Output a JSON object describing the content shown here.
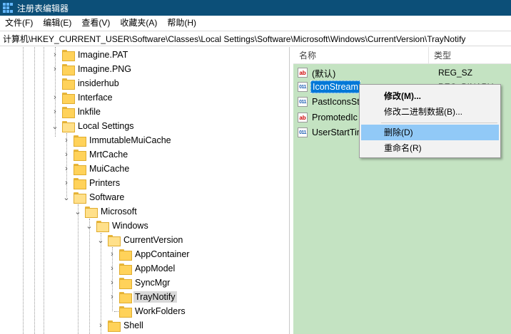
{
  "window": {
    "title": "注册表编辑器"
  },
  "menu": [
    "文件(F)",
    "编辑(E)",
    "查看(V)",
    "收藏夹(A)",
    "帮助(H)"
  ],
  "address": "计算机\\HKEY_CURRENT_USER\\Software\\Classes\\Local Settings\\Software\\Microsoft\\Windows\\CurrentVersion\\TrayNotify",
  "tree": {
    "nodes": [
      {
        "label": "Imagine.PAT",
        "expander": ">"
      },
      {
        "label": "Imagine.PNG",
        "expander": ">"
      },
      {
        "label": "insiderhub",
        "expander": ""
      },
      {
        "label": "Interface",
        "expander": ">"
      },
      {
        "label": "lnkfile",
        "expander": ">"
      },
      {
        "label": "Local Settings",
        "expander": "v"
      },
      {
        "label": "ImmutableMuiCache",
        "expander": ">"
      },
      {
        "label": "MrtCache",
        "expander": ">"
      },
      {
        "label": "MuiCache",
        "expander": ">"
      },
      {
        "label": "Printers",
        "expander": ">"
      },
      {
        "label": "Software",
        "expander": "v"
      },
      {
        "label": "Microsoft",
        "expander": "v"
      },
      {
        "label": "Windows",
        "expander": "v"
      },
      {
        "label": "CurrentVersion",
        "expander": "v"
      },
      {
        "label": "AppContainer",
        "expander": ">"
      },
      {
        "label": "AppModel",
        "expander": ">"
      },
      {
        "label": "SyncMgr",
        "expander": ">"
      },
      {
        "label": "TrayNotify",
        "expander": ">",
        "selected": true
      },
      {
        "label": "WorkFolders",
        "expander": ""
      },
      {
        "label": "Shell",
        "expander": ">"
      }
    ]
  },
  "list": {
    "headers": {
      "name": "名称",
      "type": "类型"
    },
    "entries": [
      {
        "name": "(默认)",
        "type": "REG_SZ",
        "icon": "string-value-icon"
      },
      {
        "name": "IconStream",
        "type": "REG_BINARY",
        "icon": "binary-value-icon",
        "selected": true
      },
      {
        "name": "PastIconsSt",
        "type": "",
        "icon": "binary-value-icon"
      },
      {
        "name": "PromotedIc",
        "type": "",
        "icon": "string-value-icon"
      },
      {
        "name": "UserStartTir",
        "type": "",
        "icon": "binary-value-icon"
      }
    ]
  },
  "context_menu": {
    "items": [
      {
        "label": "修改(M)...",
        "bold": true
      },
      {
        "label": "修改二进制数据(B)..."
      },
      {
        "label": "删除(D)",
        "highlighted": true
      },
      {
        "label": "重命名(R)"
      }
    ]
  },
  "colors": {
    "titlebar": "#0c4f78",
    "list_background": "#c4e3c2",
    "selection": "#0078d7",
    "menu_highlight": "#91c9f7"
  }
}
